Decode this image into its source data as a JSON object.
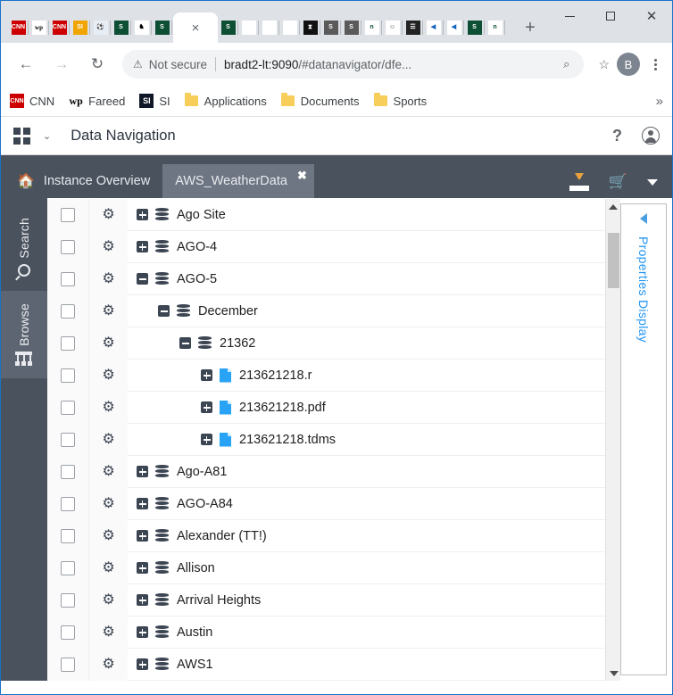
{
  "browser": {
    "tab_favicons": [
      {
        "name": "cnn",
        "glyph": "CNN",
        "cls": "fi-cnn"
      },
      {
        "name": "washington-post",
        "glyph": "wp",
        "cls": "fi-wp"
      },
      {
        "name": "cnn",
        "glyph": "CNN",
        "cls": "fi-cnn"
      },
      {
        "name": "si",
        "glyph": "SI",
        "cls": "fi-si"
      },
      {
        "name": "soccer-ball",
        "glyph": "⚽",
        "cls": "fi-ball"
      },
      {
        "name": "sharepoint-s",
        "glyph": "S",
        "cls": "fi-s"
      },
      {
        "name": "chess-knight",
        "glyph": "♞",
        "cls": "fi-knight"
      },
      {
        "name": "sharepoint-s",
        "glyph": "S",
        "cls": "fi-s"
      }
    ],
    "tab_favicons_right": [
      {
        "name": "sharepoint-s",
        "glyph": "S",
        "cls": "fi-s"
      },
      {
        "name": "chess-pawn",
        "glyph": "♟",
        "cls": "fi-pawn"
      },
      {
        "name": "chess-pawn",
        "glyph": "♟",
        "cls": "fi-pawn"
      },
      {
        "name": "chess-pawn",
        "glyph": "♟",
        "cls": "fi-pawn"
      },
      {
        "name": "hourglass",
        "glyph": "⧗",
        "cls": "fi-hour"
      },
      {
        "name": "sharepoint-s-gray",
        "glyph": "S",
        "cls": "fi-sgray"
      },
      {
        "name": "sharepoint-s-gray",
        "glyph": "S",
        "cls": "fi-sgray"
      },
      {
        "name": "n-letter",
        "glyph": "n",
        "cls": "fi-n"
      },
      {
        "name": "face",
        "glyph": "☺",
        "cls": "fi-face"
      },
      {
        "name": "building",
        "glyph": "☰",
        "cls": "fi-bld"
      },
      {
        "name": "bird",
        "glyph": "◀",
        "cls": "fi-bird"
      },
      {
        "name": "bird",
        "glyph": "◀",
        "cls": "fi-bird"
      },
      {
        "name": "sharepoint-s",
        "glyph": "S",
        "cls": "fi-s"
      },
      {
        "name": "n-letter",
        "glyph": "n",
        "cls": "fi-n"
      }
    ],
    "active_tab_close": "×",
    "new_tab": "+",
    "window_controls": {
      "minimize": "—",
      "maximize": "□",
      "close": "✕"
    },
    "nav": {
      "back": "←",
      "forward": "→",
      "reload": "↻"
    },
    "omnibox": {
      "warning_icon": "⚠",
      "security_label": "Not secure",
      "url_host": "bradt2-lt:9090",
      "url_path": "/#datanavigator/dfe...",
      "zoom_icon": "⌕",
      "star_icon": "☆",
      "avatar_initial": "B"
    },
    "bookmarks": [
      {
        "label": "CNN",
        "icon": "cnn-icon",
        "type": "site",
        "cls": "cnn",
        "glyph": "CNN"
      },
      {
        "label": "Fareed",
        "icon": "washington-post-icon",
        "type": "site",
        "cls": "wp",
        "glyph": "wp"
      },
      {
        "label": "SI",
        "icon": "si-icon",
        "type": "site",
        "cls": "si",
        "glyph": "SI"
      },
      {
        "label": "Applications",
        "icon": "folder-icon",
        "type": "folder"
      },
      {
        "label": "Documents",
        "icon": "folder-icon",
        "type": "folder"
      },
      {
        "label": "Sports",
        "icon": "folder-icon",
        "type": "folder"
      }
    ],
    "bookmarks_overflow": "»"
  },
  "app": {
    "header": {
      "title": "Data Navigation",
      "menu_icon": "grid-icon",
      "chevron": "⌄",
      "help": "?",
      "account_icon": "person-icon"
    },
    "tabs": [
      {
        "label": "Instance Overview",
        "selected": false,
        "home": true
      },
      {
        "label": "AWS_WeatherData",
        "selected": true,
        "home": false,
        "close": "✖"
      }
    ],
    "toolbar": {
      "download_icon": "download-icon",
      "cart_icon": "🛒",
      "cart_dropdown": "caret-down-icon"
    },
    "rail": [
      {
        "label": "Search",
        "icon": "search-icon",
        "active": false
      },
      {
        "label": "Browse",
        "icon": "browse-tree-icon",
        "active": true
      }
    ],
    "properties_panel": {
      "label": "Properties Display",
      "collapse_icon": "caret-left-icon"
    },
    "scrollbar": {
      "up": "▲",
      "down": "▼"
    },
    "tree": [
      {
        "label": "Ago Site",
        "indent": 0,
        "state": "collapsed",
        "type": "database"
      },
      {
        "label": "AGO-4",
        "indent": 0,
        "state": "collapsed",
        "type": "database"
      },
      {
        "label": "AGO-5",
        "indent": 0,
        "state": "expanded",
        "type": "database"
      },
      {
        "label": "December",
        "indent": 1,
        "state": "expanded",
        "type": "database"
      },
      {
        "label": "21362",
        "indent": 2,
        "state": "expanded",
        "type": "database"
      },
      {
        "label": "213621218.r",
        "indent": 3,
        "state": "collapsed",
        "type": "file"
      },
      {
        "label": "213621218.pdf",
        "indent": 3,
        "state": "collapsed",
        "type": "file"
      },
      {
        "label": "213621218.tdms",
        "indent": 3,
        "state": "collapsed",
        "type": "file"
      },
      {
        "label": "Ago-A81",
        "indent": 0,
        "state": "collapsed",
        "type": "database"
      },
      {
        "label": "AGO-A84",
        "indent": 0,
        "state": "collapsed",
        "type": "database"
      },
      {
        "label": "Alexander (TT!)",
        "indent": 0,
        "state": "collapsed",
        "type": "database"
      },
      {
        "label": "Allison",
        "indent": 0,
        "state": "collapsed",
        "type": "database"
      },
      {
        "label": "Arrival Heights",
        "indent": 0,
        "state": "collapsed",
        "type": "database"
      },
      {
        "label": "Austin",
        "indent": 0,
        "state": "collapsed",
        "type": "database"
      },
      {
        "label": "AWS1",
        "indent": 0,
        "state": "collapsed",
        "type": "database"
      }
    ],
    "row_controls": {
      "checkbox": "row-checkbox",
      "gear": "⚙"
    }
  },
  "colors": {
    "chrome_tabstrip": "#dee1e6",
    "app_dark": "#4a525e",
    "tab_selected": "#6e7683",
    "accent_blue": "#2196f3",
    "file_blue": "#29a3f5",
    "window_border": "#1a73c9"
  }
}
